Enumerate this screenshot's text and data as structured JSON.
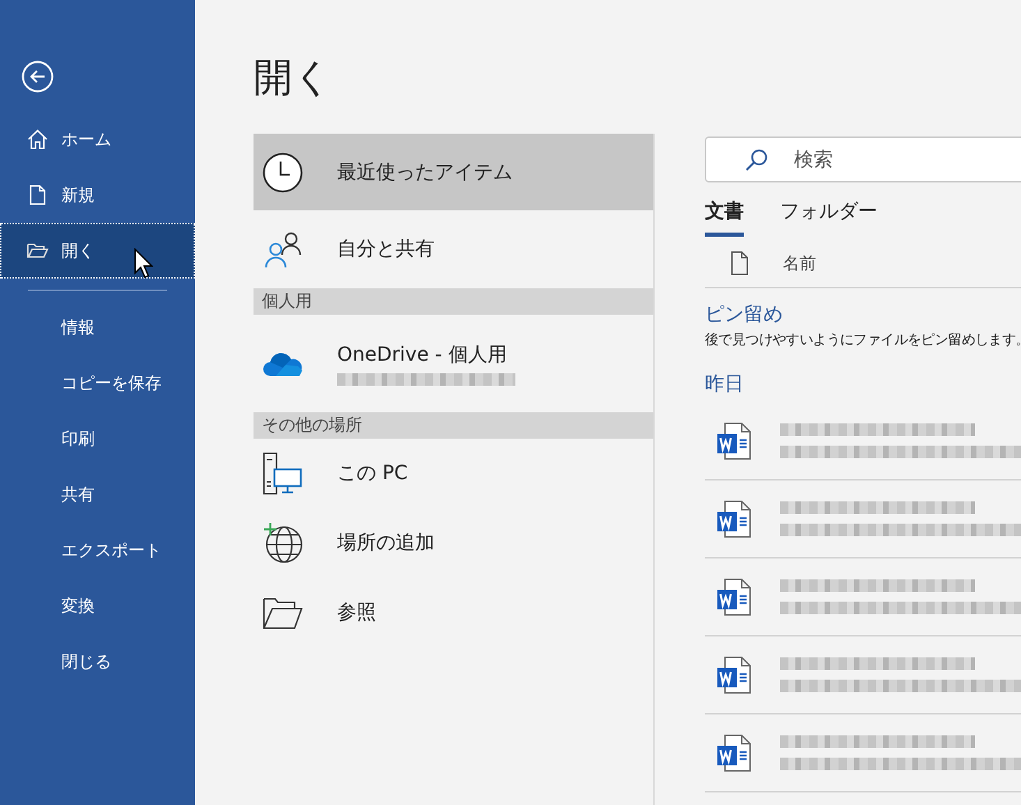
{
  "sidebar": {
    "primary_items": [
      {
        "label": "ホーム",
        "selected": false
      },
      {
        "label": "新規",
        "selected": false
      },
      {
        "label": "開く",
        "selected": true
      }
    ],
    "secondary_items": [
      {
        "label": "情報"
      },
      {
        "label": "コピーを保存"
      },
      {
        "label": "印刷"
      },
      {
        "label": "共有"
      },
      {
        "label": "エクスポート"
      },
      {
        "label": "変換"
      },
      {
        "label": "閉じる"
      }
    ]
  },
  "page_title": "開く",
  "places": [
    {
      "kind": "item",
      "label": "最近使ったアイテム",
      "selected": true
    },
    {
      "kind": "item",
      "label": "自分と共有",
      "selected": false
    },
    {
      "kind": "header",
      "label": "個人用"
    },
    {
      "kind": "account",
      "label": "OneDrive - 個人用",
      "selected": false
    },
    {
      "kind": "header",
      "label": "その他の場所"
    },
    {
      "kind": "item",
      "label": "この PC",
      "selected": false
    },
    {
      "kind": "item",
      "label": "場所の追加",
      "selected": false
    },
    {
      "kind": "item",
      "label": "参照",
      "selected": false
    }
  ],
  "search": {
    "placeholder": "検索"
  },
  "tabs": [
    {
      "label": "文書",
      "selected": true
    },
    {
      "label": "フォルダー",
      "selected": false
    }
  ],
  "column_header": "名前",
  "pinned": {
    "title": "ピン留め",
    "hint": "後で見つけやすいようにファイルをピン留めします。"
  },
  "groups": [
    {
      "title": "昨日",
      "files": [
        {
          "kind": "word"
        },
        {
          "kind": "word"
        },
        {
          "kind": "word"
        },
        {
          "kind": "word"
        },
        {
          "kind": "word"
        }
      ]
    }
  ]
}
